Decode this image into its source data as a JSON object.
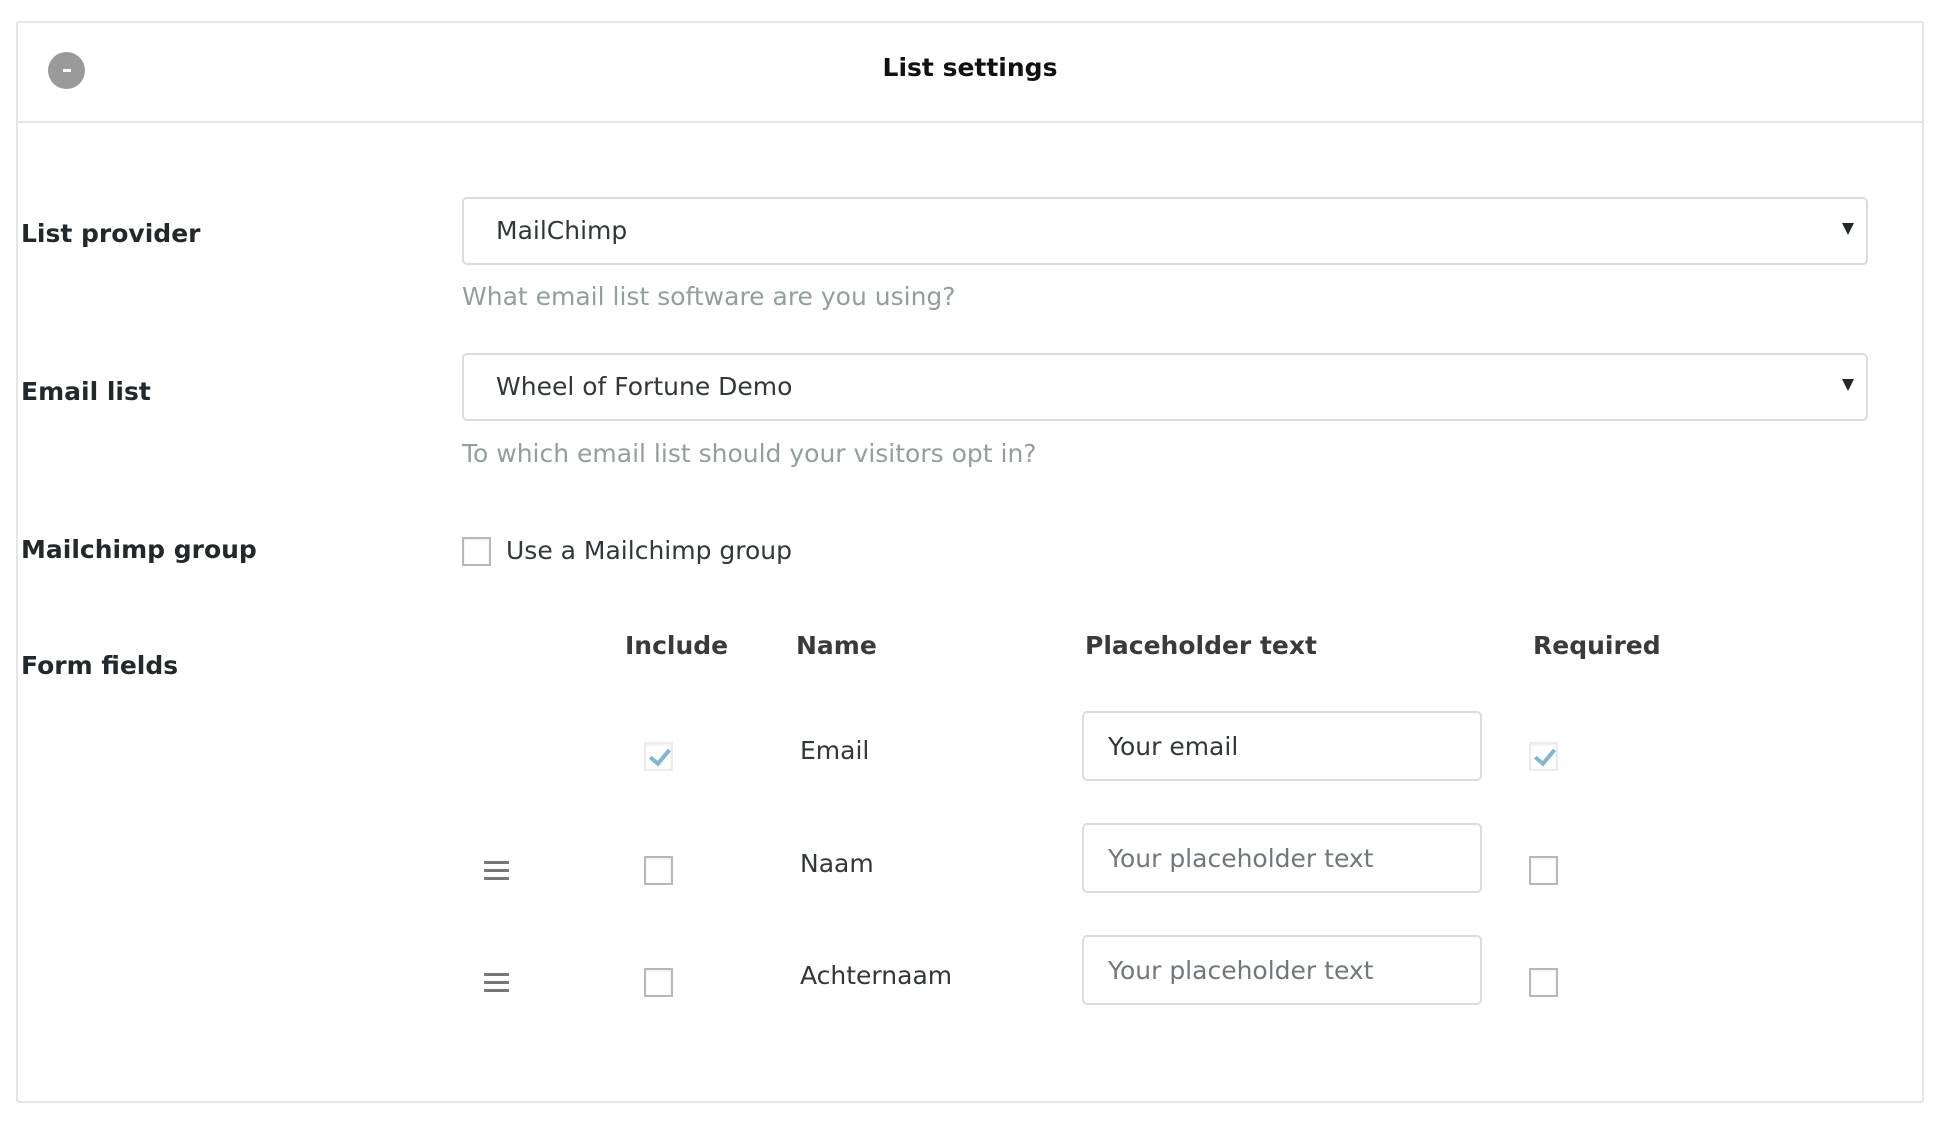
{
  "panel": {
    "title": "List settings",
    "collapse_icon": "minus-circle-icon"
  },
  "list_provider": {
    "label": "List provider",
    "selected": "MailChimp",
    "help": "What email list software are you using?"
  },
  "email_list": {
    "label": "Email list",
    "selected": "Wheel of Fortune Demo",
    "help": "To which email list should your visitors opt in?"
  },
  "mailchimp_group": {
    "label": "Mailchimp group",
    "checkbox_label": "Use a Mailchimp group",
    "checked": false
  },
  "form_fields": {
    "label": "Form fields",
    "columns": {
      "include": "Include",
      "name": "Name",
      "placeholder": "Placeholder text",
      "required": "Required"
    },
    "rows": [
      {
        "name": "Email",
        "include": true,
        "required": true,
        "value": "Your email",
        "placeholder": "",
        "draggable": false,
        "locked": true
      },
      {
        "name": "Naam",
        "include": false,
        "required": false,
        "value": "",
        "placeholder": "Your placeholder text",
        "draggable": true,
        "locked": false
      },
      {
        "name": "Achternaam",
        "include": false,
        "required": false,
        "value": "",
        "placeholder": "Your placeholder text",
        "draggable": true,
        "locked": false
      }
    ]
  },
  "colors": {
    "check_mark": "#82b7d1",
    "help_text": "#959e9e",
    "border": "#dcdcdc",
    "collapse_button": "#9a9a9a"
  }
}
